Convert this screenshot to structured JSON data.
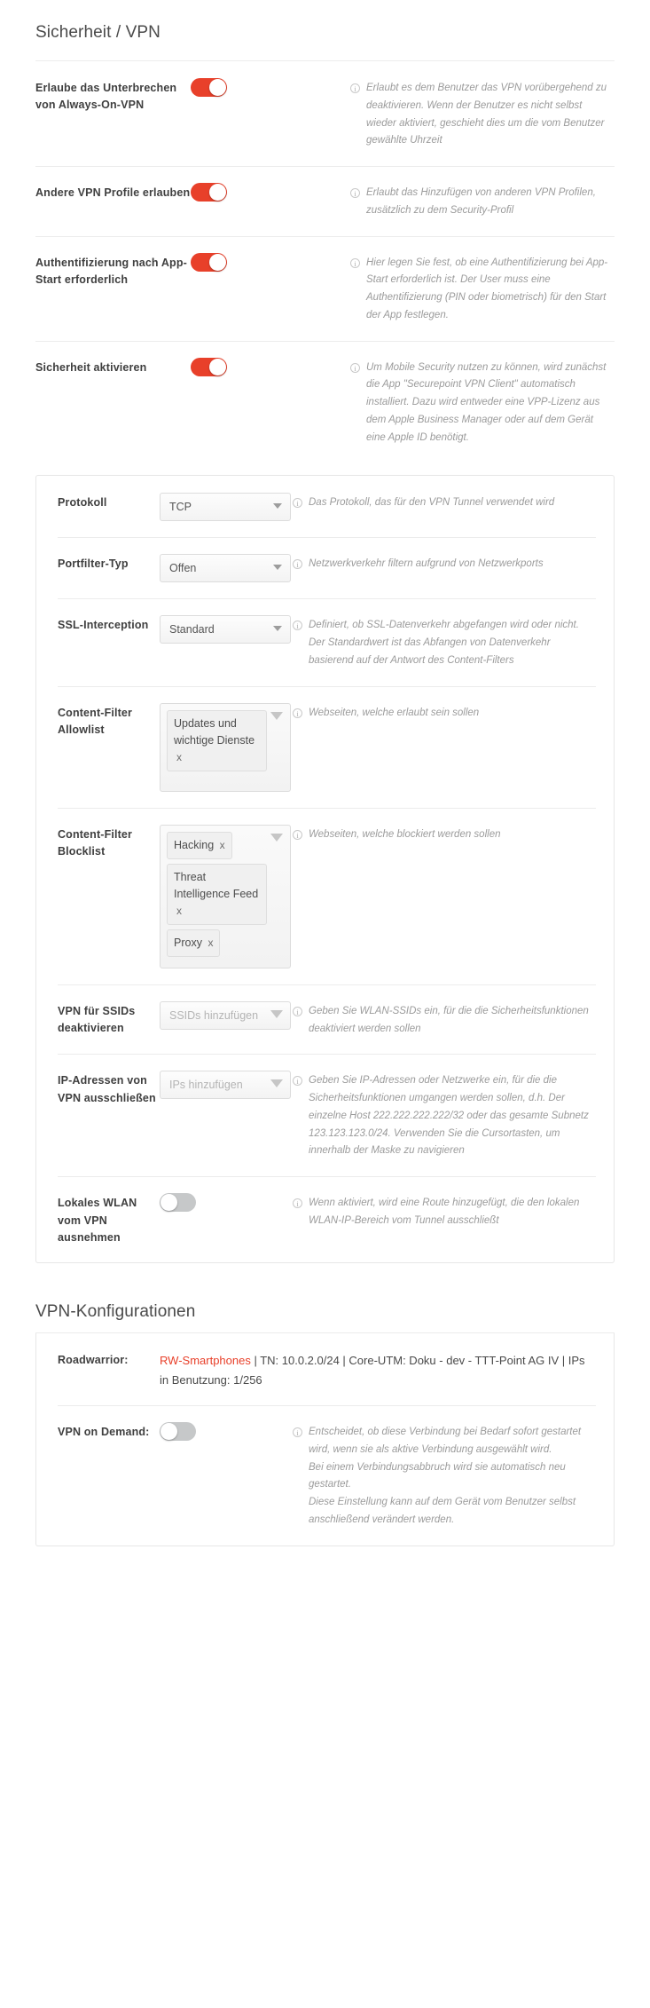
{
  "page": {
    "section_title": "Sicherheit / VPN",
    "configs_title": "VPN-Konfigurationen"
  },
  "colors": {
    "accent": "#e8402a",
    "toggle_off": "#c6c8c9",
    "label": "#3f3f3f",
    "hint": "#9b9b9b"
  },
  "icons": {
    "info": "i"
  },
  "toggles": [
    {
      "label": "Erlaube das Unterbrechen von Always-On-VPN",
      "state": "on",
      "hint": "Erlaubt es dem Benutzer das VPN vorübergehend zu deaktivieren. Wenn der Benutzer es nicht selbst wieder aktiviert, geschieht dies um die vom Benutzer gewählte Uhrzeit"
    },
    {
      "label": "Andere VPN Profile erlauben",
      "state": "on",
      "hint": "Erlaubt das Hinzufügen von anderen VPN Profilen, zusätzlich zu dem Security-Profil"
    },
    {
      "label": "Authentifizierung nach App-Start erforderlich",
      "state": "on",
      "hint": "Hier legen Sie fest, ob eine Authentifizierung bei App-Start erforderlich ist. Der User muss eine Authentifizierung (PIN oder biometrisch) für den Start der App festlegen."
    },
    {
      "label": "Sicherheit aktivieren",
      "state": "on",
      "hint": "Um Mobile Security nutzen zu können, wird zunächst die App \"Securepoint VPN Client\" automatisch installiert. Dazu wird entweder eine VPP-Lizenz aus dem Apple Business Manager oder auf dem Gerät eine Apple ID benötigt."
    }
  ],
  "card": {
    "protokoll": {
      "label": "Protokoll",
      "value": "TCP",
      "hint": "Das Protokoll, das für den VPN Tunnel verwendet wird"
    },
    "portfilter": {
      "label": "Portfilter-Typ",
      "value": "Offen",
      "hint": "Netzwerkverkehr filtern aufgrund von Netzwerkports"
    },
    "ssl": {
      "label": "SSL-Interception",
      "value": "Standard",
      "hint": "Definiert, ob SSL-Datenverkehr abgefangen wird oder nicht. Der Standardwert ist das Abfangen von Datenverkehr basierend auf der Antwort des Content-Filters"
    },
    "allowlist": {
      "label": "Content-Filter Allowlist",
      "tags": [
        "Updates und wichtige Dienste"
      ],
      "remove_label": "x",
      "hint": "Webseiten, welche erlaubt sein sollen"
    },
    "blocklist": {
      "label": "Content-Filter Blocklist",
      "tags": [
        "Hacking",
        "Threat Intelligence Feed",
        "Proxy"
      ],
      "remove_label": "x",
      "hint": "Webseiten, welche blockiert werden sollen"
    },
    "ssids": {
      "label": "VPN für SSIDs deaktivieren",
      "placeholder": "SSIDs hinzufügen",
      "hint": "Geben Sie WLAN-SSIDs ein, für die die Sicherheitsfunktionen deaktiviert werden sollen"
    },
    "ips": {
      "label": "IP-Adressen von VPN ausschließen",
      "placeholder": "IPs hinzufügen",
      "hint": "Geben Sie IP-Adressen oder Netzwerke ein, für die die Sicherheitsfunktionen umgangen werden sollen, d.h. Der einzelne Host 222.222.222.222/32 oder das gesamte Subnetz 123.123.123.0/24. Verwenden Sie die Cursortasten, um innerhalb der Maske zu navigieren"
    },
    "wlan": {
      "label": "Lokales WLAN vom VPN ausnehmen",
      "state": "off",
      "hint": "Wenn aktiviert, wird eine Route hinzugefügt, die den lokalen WLAN-IP-Bereich vom Tunnel ausschließt"
    }
  },
  "configs": {
    "roadwarrior": {
      "label": "Roadwarrior:",
      "name": "RW-Smartphones",
      "details": " | TN: 10.0.2.0/24 | Core-UTM: Doku - dev - TTT-Point AG IV | IPs in Benutzung: 1/256"
    },
    "vpn_on_demand": {
      "label": "VPN on Demand:",
      "state": "off",
      "hint": "Entscheidet, ob diese Verbindung bei Bedarf sofort gestartet wird, wenn sie als aktive Verbindung ausgewählt wird.\nBei einem Verbindungsabbruch wird sie automatisch neu gestartet.\nDiese Einstellung kann auf dem Gerät vom Benutzer selbst anschließend verändert werden."
    }
  }
}
